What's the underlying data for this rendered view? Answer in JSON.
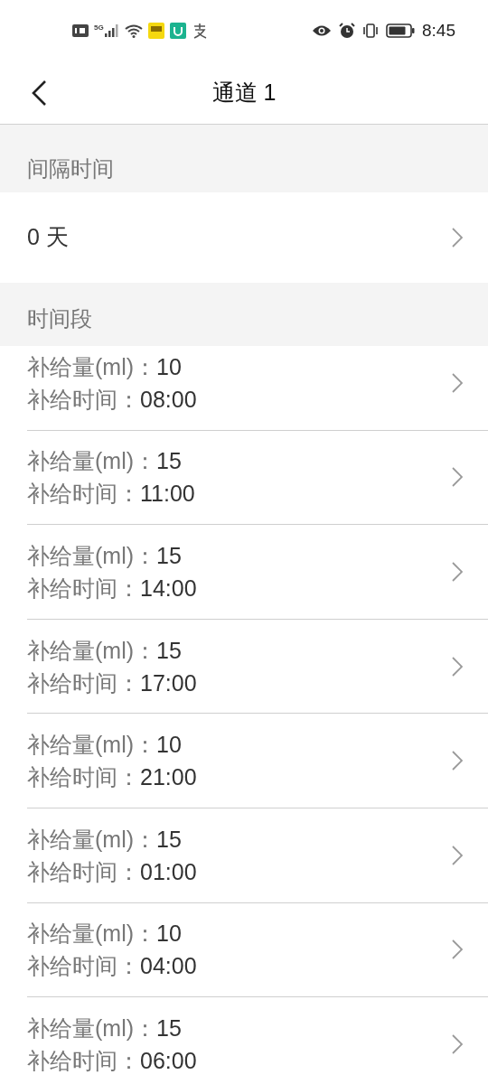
{
  "status_bar": {
    "time": "8:45",
    "network": "5G"
  },
  "header": {
    "title": "通道 1"
  },
  "interval": {
    "heading": "间隔时间",
    "value": "0 天"
  },
  "periods": {
    "heading": "时间段",
    "items": [
      {
        "amount_label": "补给量(ml)：",
        "amount": "10",
        "time_label": "补给时间：",
        "time": "08:00"
      },
      {
        "amount_label": "补给量(ml)：",
        "amount": "15",
        "time_label": "补给时间：",
        "time": "11:00"
      },
      {
        "amount_label": "补给量(ml)：",
        "amount": "15",
        "time_label": "补给时间：",
        "time": "14:00"
      },
      {
        "amount_label": "补给量(ml)：",
        "amount": "15",
        "time_label": "补给时间：",
        "time": "17:00"
      },
      {
        "amount_label": "补给量(ml)：",
        "amount": "10",
        "time_label": "补给时间：",
        "time": "21:00"
      },
      {
        "amount_label": "补给量(ml)：",
        "amount": "15",
        "time_label": "补给时间：",
        "time": "01:00"
      },
      {
        "amount_label": "补给量(ml)：",
        "amount": "10",
        "time_label": "补给时间：",
        "time": "04:00"
      },
      {
        "amount_label": "补给量(ml)：",
        "amount": "15",
        "time_label": "补给时间：",
        "time": "06:00"
      }
    ]
  }
}
